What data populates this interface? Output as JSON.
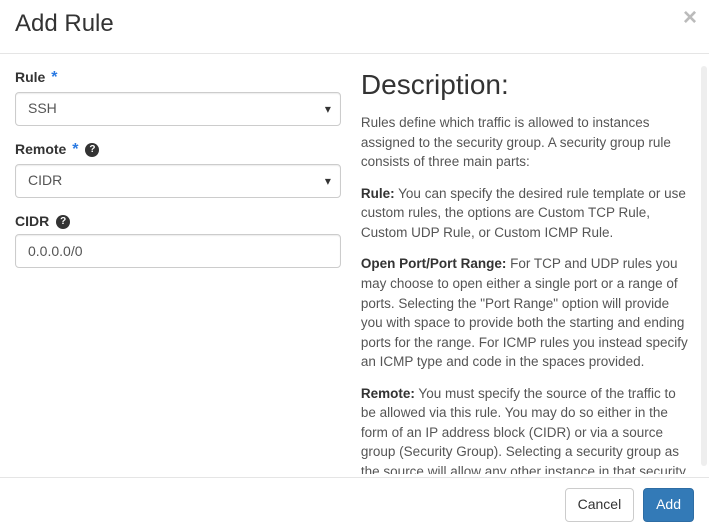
{
  "header": {
    "title": "Add Rule"
  },
  "form": {
    "rule": {
      "label": "Rule",
      "value": "SSH"
    },
    "remote": {
      "label": "Remote",
      "value": "CIDR"
    },
    "cidr": {
      "label": "CIDR",
      "value": "0.0.0.0/0"
    }
  },
  "description": {
    "heading": "Description:",
    "intro": "Rules define which traffic is allowed to instances assigned to the security group. A security group rule consists of three main parts:",
    "rule_label": "Rule:",
    "rule_text": " You can specify the desired rule template or use custom rules, the options are Custom TCP Rule, Custom UDP Rule, or Custom ICMP Rule.",
    "port_label": "Open Port/Port Range:",
    "port_text": " For TCP and UDP rules you may choose to open either a single port or a range of ports. Selecting the \"Port Range\" option will provide you with space to provide both the starting and ending ports for the range. For ICMP rules you instead specify an ICMP type and code in the spaces provided.",
    "remote_label": "Remote:",
    "remote_text": " You must specify the source of the traffic to be allowed via this rule. You may do so either in the form of an IP address block (CIDR) or via a source group (Security Group). Selecting a security group as the source will allow any other instance in that security group access to any other instance via this rule."
  },
  "footer": {
    "cancel": "Cancel",
    "add": "Add"
  }
}
